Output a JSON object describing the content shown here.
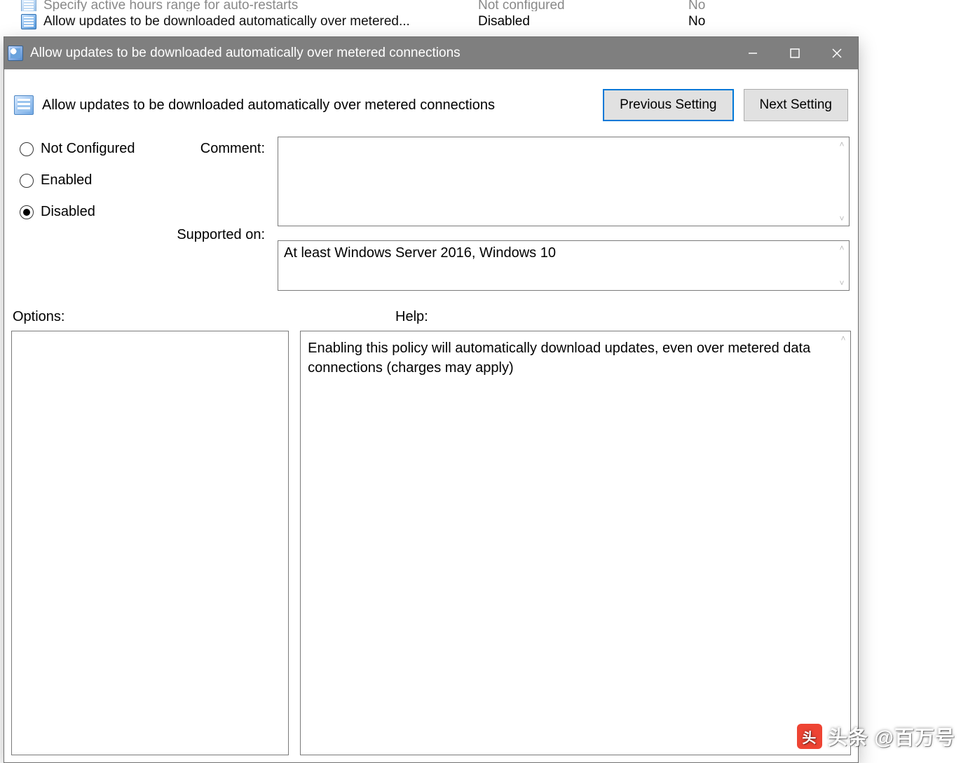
{
  "background": {
    "rows": [
      {
        "name": "Specify active hours range for auto-restarts",
        "state": "Not configured",
        "comment": "No"
      },
      {
        "name": "Allow updates to be downloaded automatically over metered...",
        "state": "Disabled",
        "comment": "No"
      }
    ]
  },
  "dialog": {
    "title": "Allow updates to be downloaded automatically over metered connections",
    "policy_title": "Allow updates to be downloaded automatically over metered connections",
    "prev_label": "Previous Setting",
    "next_label": "Next Setting",
    "radios": {
      "not_configured": "Not Configured",
      "enabled": "Enabled",
      "disabled": "Disabled",
      "selected": "disabled"
    },
    "comment_label": "Comment:",
    "comment_value": "",
    "supported_label": "Supported on:",
    "supported_value": "At least Windows Server 2016, Windows 10",
    "options_label": "Options:",
    "help_label": "Help:",
    "help_text": "Enabling this policy will automatically download updates, even over metered data connections (charges may apply)"
  },
  "watermark": "头条 @百万号"
}
